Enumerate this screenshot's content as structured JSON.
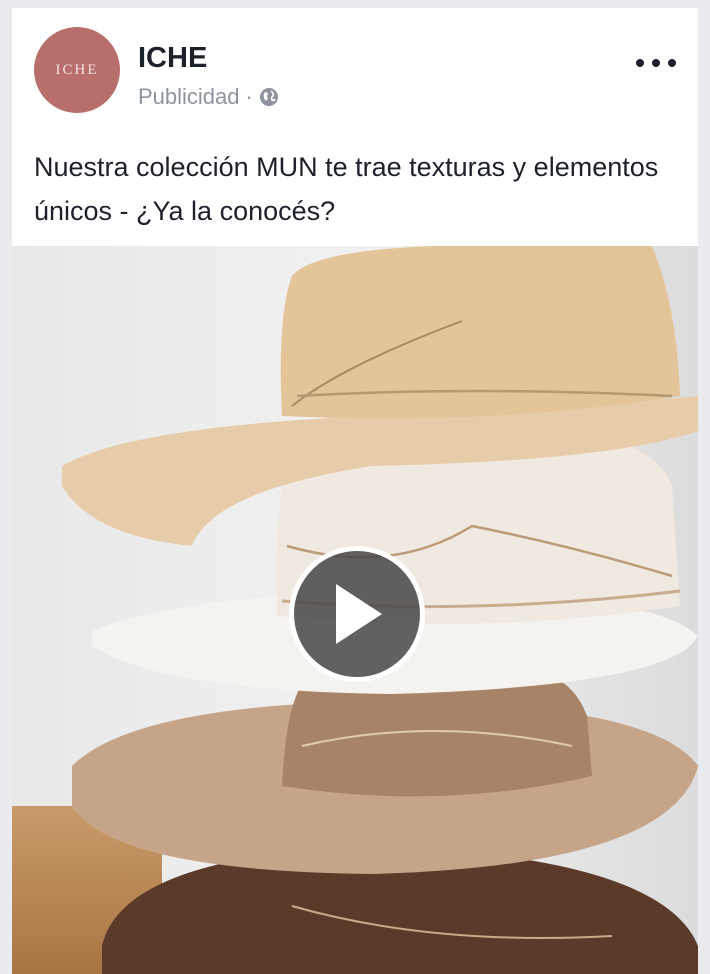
{
  "post": {
    "page_name": "ICHE",
    "avatar_text": "ICHE",
    "sponsored_label": "Publicidad",
    "separator": "·",
    "caption": "Nuestra colección MUN te trae texturas y elementos únicos - ¿Ya la conocés?",
    "audience_icon": "globe-icon",
    "more_icon": "more-options-icon"
  },
  "video": {
    "content": "stack of felt hats",
    "play_icon": "play-icon"
  },
  "colors": {
    "avatar": "#b86e6a",
    "name": "#1d2129",
    "meta": "#8d949e"
  }
}
